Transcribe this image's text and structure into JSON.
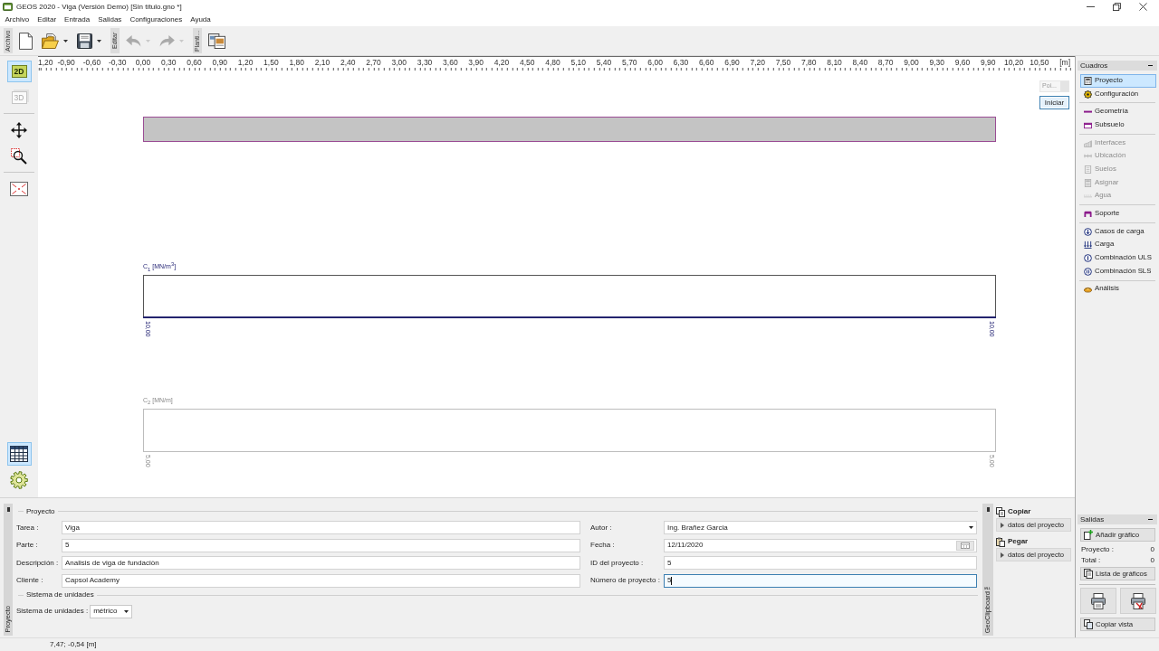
{
  "window": {
    "title": "GEOS 2020 - Viga (Versión Demo) [Sin título.gno *]"
  },
  "menu": [
    "Archivo",
    "Editar",
    "Entrada",
    "Salidas",
    "Configuraciones",
    "Ayuda"
  ],
  "toolbar": [
    {
      "label": "Archivo",
      "buttons": [
        {
          "disabled": false,
          "dropdown": false
        },
        {
          "disabled": false,
          "dropdown": true
        },
        {
          "disabled": false,
          "dropdown": true
        }
      ]
    },
    {
      "label": "Editar",
      "buttons": [
        {
          "disabled": true,
          "dropdown": true
        },
        {
          "disabled": true,
          "dropdown": true
        }
      ]
    },
    {
      "label": "Planti...",
      "buttons": [
        {
          "disabled": false,
          "dropdown": false
        }
      ]
    }
  ],
  "view_modes": [
    {
      "label": "2D",
      "selected": true,
      "disabled": false
    },
    {
      "label": "3D",
      "selected": false,
      "disabled": true
    }
  ],
  "panel_modes": [
    {
      "selected": true
    },
    {
      "selected": false
    }
  ],
  "ruler": {
    "labels": [
      "1,20",
      "-0,90",
      "-0,60",
      "-0,30",
      "0,00",
      "0,30",
      "0,60",
      "0,90",
      "1,20",
      "1,50",
      "1,80",
      "2,10",
      "2,40",
      "2,70",
      "3,00",
      "3,30",
      "3,60",
      "3,90",
      "4,20",
      "4,50",
      "4,80",
      "5,10",
      "5,40",
      "5,70",
      "6,00",
      "6,30",
      "6,60",
      "6,90",
      "7,20",
      "7,50",
      "7,80",
      "8,10",
      "8,40",
      "8,70",
      "9,00",
      "9,30",
      "9,60",
      "9,90",
      "10,20",
      "10,50"
    ],
    "unit": "[m]"
  },
  "canvas": {
    "overlay": {
      "field": "Poi...",
      "button": "Iniciar"
    },
    "diagrams": [
      {
        "label": "C$_{1}$ [MN/m$^{3}$]",
        "values": [
          "10,00",
          "10,00"
        ],
        "active": true
      },
      {
        "label": "C$_{2}$ [MN/m]",
        "values": [
          "5,00",
          "5,00"
        ],
        "active": false
      }
    ]
  },
  "frames": {
    "title": "Cuadros",
    "groups": [
      {
        "items": [
          {
            "label": "Proyecto",
            "selected": true,
            "disabled": false
          },
          {
            "label": "Configuración",
            "selected": false,
            "disabled": false
          }
        ]
      },
      {
        "items": [
          {
            "label": "Geometría",
            "selected": false,
            "disabled": false
          },
          {
            "label": "Subsuelo",
            "selected": false,
            "disabled": false
          }
        ]
      },
      {
        "items": [
          {
            "label": "Interfaces",
            "selected": false,
            "disabled": true
          },
          {
            "label": "Ubicación",
            "selected": false,
            "disabled": true
          },
          {
            "label": "Suelos",
            "selected": false,
            "disabled": true
          },
          {
            "label": "Asignar",
            "selected": false,
            "disabled": true
          },
          {
            "label": "Agua",
            "selected": false,
            "disabled": true
          }
        ]
      },
      {
        "items": [
          {
            "label": "Soporte",
            "selected": false,
            "disabled": false
          }
        ]
      },
      {
        "items": [
          {
            "label": "Casos de carga",
            "selected": false,
            "disabled": false
          },
          {
            "label": "Carga",
            "selected": false,
            "disabled": false
          },
          {
            "label": "Combinación ULS",
            "selected": false,
            "disabled": false
          },
          {
            "label": "Combinación SLS",
            "selected": false,
            "disabled": false
          }
        ]
      },
      {
        "items": [
          {
            "label": "Análisis",
            "selected": false,
            "disabled": false
          }
        ]
      }
    ]
  },
  "project_panel": {
    "tab": "Proyecto",
    "sections": [
      {
        "title": "Proyecto",
        "columns": [
          [
            {
              "label": "Tarea :",
              "value": "Viga",
              "kind": "text",
              "focused": false
            },
            {
              "label": "Parte :",
              "value": "5",
              "kind": "text",
              "focused": false
            },
            {
              "label": "Descripción :",
              "value": "Analisis de viga de fundaciòn",
              "kind": "text",
              "focused": false
            },
            {
              "label": "Cliente :",
              "value": "Capsol Academy",
              "kind": "text",
              "focused": false
            }
          ],
          [
            {
              "label": "Autor :",
              "value": "Ing. Brañez Garcia",
              "kind": "dropdown",
              "focused": false
            },
            {
              "label": "Fecha :",
              "value": "12/11/2020",
              "kind": "date",
              "focused": false
            },
            {
              "label": "ID del proyecto :",
              "value": "5",
              "kind": "text",
              "focused": false
            },
            {
              "label": "Número de proyecto :",
              "value": "5",
              "kind": "text",
              "focused": true
            }
          ]
        ]
      },
      {
        "title": "Sistema de unidades",
        "columns": [
          [
            {
              "label": "Sistema de unidades :",
              "value": "métrico",
              "kind": "dropdown",
              "focused": false
            }
          ]
        ]
      }
    ]
  },
  "clipboard": {
    "tab": "GeoClipboard™",
    "actions": [
      {
        "title": "Copiar",
        "button": "datos del proyecto"
      },
      {
        "title": "Pegar",
        "button": "datos del proyecto"
      }
    ]
  },
  "outputs": {
    "title": "Salidas",
    "add_button": "Añadir gráfico",
    "counts": [
      {
        "label": "Proyecto :",
        "value": "0"
      },
      {
        "label": "Total :",
        "value": "0"
      }
    ],
    "list_button": "Lista de gráficos",
    "copy_button": "Copiar vista"
  },
  "status_bar": {
    "coordinates": "7,47; -0,54 [m]"
  }
}
